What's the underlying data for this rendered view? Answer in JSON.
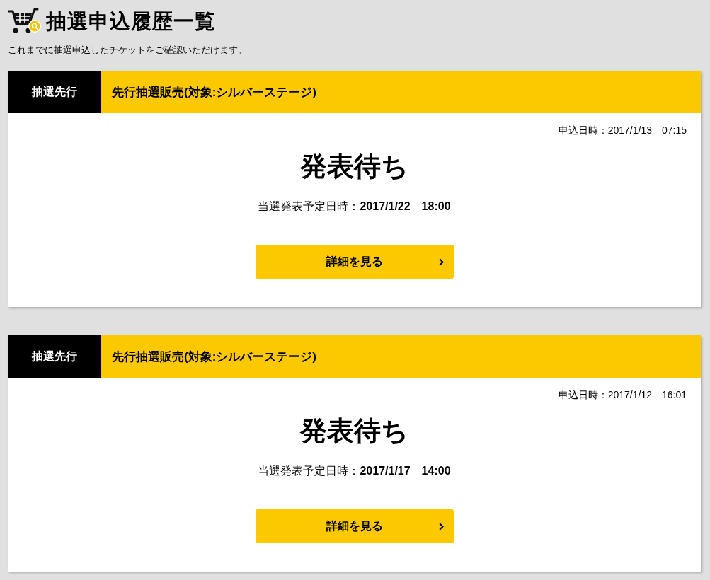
{
  "page": {
    "title": "抽選申込履歴一覧",
    "description": "これまでに抽選申込したチケットをご確認いただけます。"
  },
  "applications": [
    {
      "tag": "抽選先行",
      "name": "先行抽選販売(対象:シルバーステージ)",
      "applied_at": "申込日時：2017/1/13　07:15",
      "status": "発表待ち",
      "announcement": "当選発表予定日時：**2017/1/22　18:00**",
      "button": "詳細を見る"
    },
    {
      "tag": "抽選先行",
      "name": "先行抽選販売(対象:シルバーステージ)",
      "applied_at": "申込日時：2017/1/12　16:01",
      "status": "発表待ち",
      "announcement": "当選発表予定日時：**2017/1/17　14:00**",
      "button": "詳細を見る"
    }
  ]
}
